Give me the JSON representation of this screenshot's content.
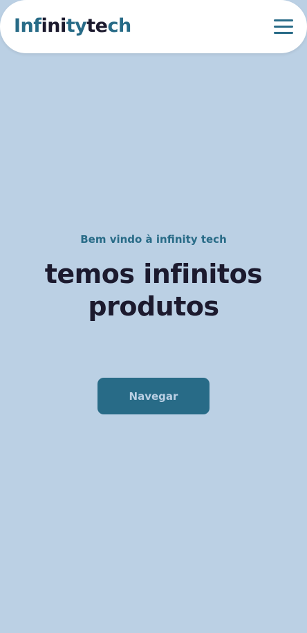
{
  "header": {
    "logo": {
      "parts": [
        "Inf",
        "ini",
        "ty",
        "te",
        "ch"
      ]
    },
    "menu_icon": "hamburger-menu-icon"
  },
  "hero": {
    "welcome": "Bem vindo à infinity tech",
    "headline_line1": "temos infinitos",
    "headline_line2": "produtos",
    "cta_label": "Navegar"
  },
  "colors": {
    "background": "#bbd0e4",
    "header_bg": "#ffffff",
    "primary": "#286b87",
    "dark": "#1c1a2e"
  }
}
